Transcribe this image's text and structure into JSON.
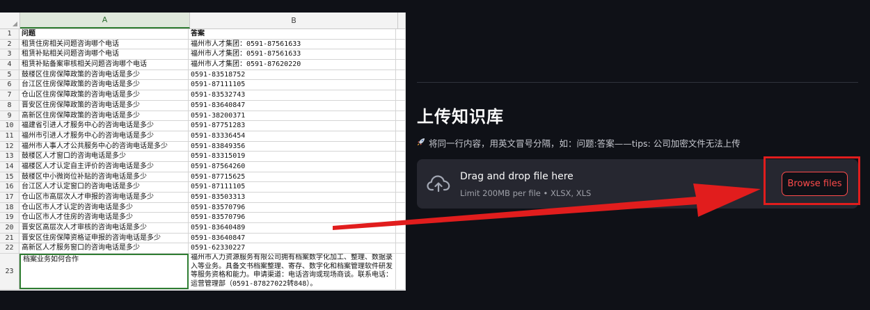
{
  "sheet": {
    "col_a": "A",
    "col_b": "B",
    "header_row": {
      "num": "1",
      "a": "问题",
      "b": "答案"
    },
    "rows": [
      {
        "num": "2",
        "a": "租赁住房相关问题咨询哪个电话",
        "b": "福州市人才集团：0591-87561633"
      },
      {
        "num": "3",
        "a": "租赁补贴相关问题咨询哪个电话",
        "b": "福州市人才集团：0591-87561633"
      },
      {
        "num": "4",
        "a": "租赁补贴备案审核相关问题咨询哪个电话",
        "b": "福州市人才集团：0591-87620220"
      },
      {
        "num": "5",
        "a": "鼓楼区住房保障政策的咨询电话是多少",
        "b": "0591-83518752"
      },
      {
        "num": "6",
        "a": "台江区住房保障政策的咨询电话是多少",
        "b": "0591-87111105"
      },
      {
        "num": "7",
        "a": "仓山区住房保障政策的咨询电话是多少",
        "b": "0591-83532743"
      },
      {
        "num": "8",
        "a": "晋安区住房保障政策的咨询电话是多少",
        "b": "0591-83640847"
      },
      {
        "num": "9",
        "a": "高新区住房保障政策的咨询电话是多少",
        "b": "0591-38200371"
      },
      {
        "num": "10",
        "a": "福建省引进人才服务中心的咨询电话是多少",
        "b": "0591-87751283"
      },
      {
        "num": "11",
        "a": "福州市引进人才服务中心的咨询电话是多少",
        "b": "0591-83336454"
      },
      {
        "num": "12",
        "a": "福州市人事人才公共服务中心的咨询电话是多少",
        "b": "0591-83849356"
      },
      {
        "num": "13",
        "a": "鼓楼区人才窗口的咨询电话是多少",
        "b": "0591-83315019"
      },
      {
        "num": "14",
        "a": "福楼区人才认定自主评价的咨询电话是多少",
        "b": "0591-87564260"
      },
      {
        "num": "15",
        "a": "鼓楼区中小微岗位补贴的咨询电话是多少",
        "b": "0591-87715625"
      },
      {
        "num": "16",
        "a": "台江区人才认定窗口的咨询电话是多少",
        "b": "0591-87111105"
      },
      {
        "num": "17",
        "a": "仓山区市高层次人才申报的咨询电话是多少",
        "b": "0591-83503313"
      },
      {
        "num": "18",
        "a": "仓山区市人才认定的咨询电话是多少",
        "b": "0591-83570796"
      },
      {
        "num": "19",
        "a": "仓山区市人才住房的咨询电话是多少",
        "b": "0591-83570796"
      },
      {
        "num": "20",
        "a": "晋安区高层次人才审核的咨询电话是多少",
        "b": "0591-83640489"
      },
      {
        "num": "21",
        "a": "晋安区住房保障资格证申报的咨询电话是多少",
        "b": "0591-83640847"
      },
      {
        "num": "22",
        "a": "高新区人才服务窗口的咨询电话是多少",
        "b": "0591-62330227"
      }
    ],
    "big_row": {
      "num": "23",
      "a": "档案业务如何合作",
      "b": "福州市人力资源服务有限公司拥有档案数字化加工、整理、数据录入等业务。具备文书档案整理、寄存、数字化和档案管理软件研发等服务资格和能力。申请渠道：电话咨询或现场商谈。联系电话：运营管理部（0591-87827022转848）。"
    }
  },
  "uploader": {
    "title": "上传知识库",
    "caption_icon": "rocket-icon",
    "caption": "将同一行内容，用英文冒号分隔，如：问题:答案——tips: 公司加密文件无法上传",
    "drop_title": "Drag and drop file here",
    "drop_limit": "Limit 200MB per file • XLSX, XLS",
    "browse_label": "Browse files"
  },
  "colors": {
    "background": "#0f1117",
    "dropzone": "#262730",
    "accent_red": "#ff4b4b",
    "annotation_red": "#e11d1d",
    "selected_green": "#2f7d32"
  }
}
